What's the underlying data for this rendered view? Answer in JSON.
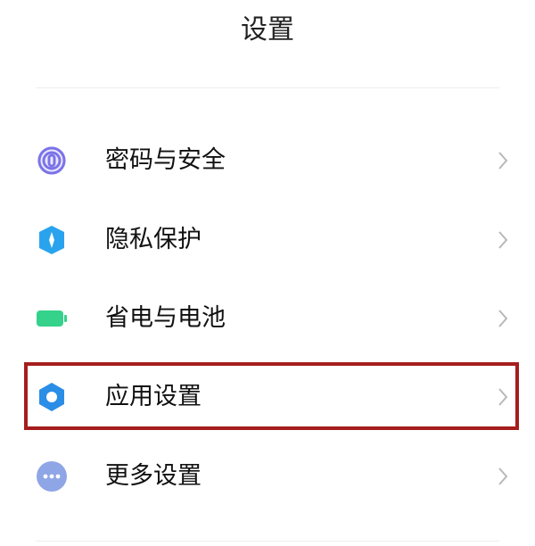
{
  "page": {
    "title": "设置"
  },
  "settings_items": [
    {
      "label": "密码与安全",
      "icon": "fingerprint-icon",
      "icon_color": "#7b73e8"
    },
    {
      "label": "隐私保护",
      "icon": "shield-icon",
      "icon_color": "#2aa3ef"
    },
    {
      "label": "省电与电池",
      "icon": "battery-icon",
      "icon_color": "#34d28a"
    },
    {
      "label": "应用设置",
      "icon": "gear-icon",
      "icon_color": "#2a8de6",
      "highlighted": true
    },
    {
      "label": "更多设置",
      "icon": "more-dots-icon",
      "icon_color": "#8fa6e6"
    }
  ],
  "colors": {
    "highlight_border": "#a51d1d",
    "chevron": "#b8b8b8",
    "divider": "#eeeeee"
  }
}
